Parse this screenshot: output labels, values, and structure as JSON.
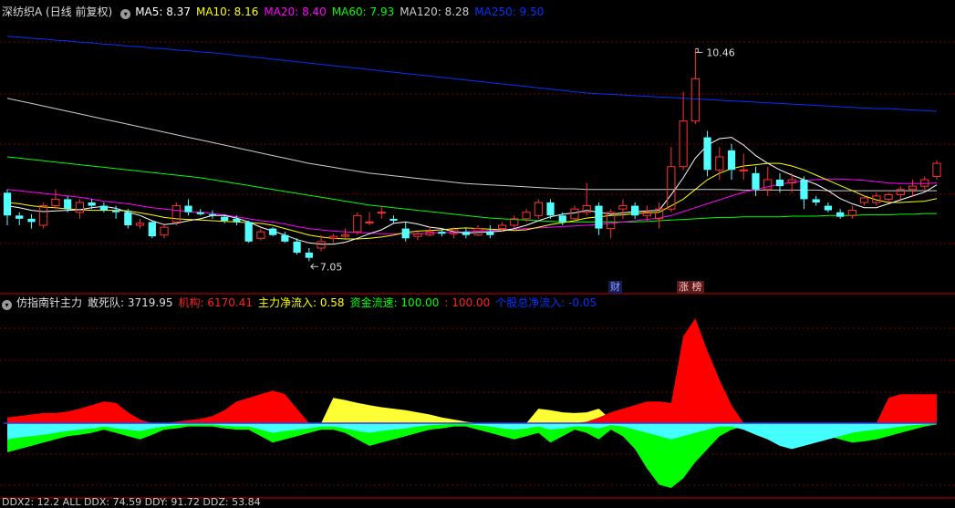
{
  "main_header": {
    "title": "深纺织A (日线 前复权)",
    "ma": [
      {
        "label": "MA5: 8.37",
        "color": "#ffffff"
      },
      {
        "label": "MA10: 8.16",
        "color": "#ffff00"
      },
      {
        "label": "MA20: 8.40",
        "color": "#ff00ff"
      },
      {
        "label": "MA60: 7.93",
        "color": "#00ff00"
      },
      {
        "label": "MA120: 8.28",
        "color": "#cccccc"
      },
      {
        "label": "MA250: 9.50",
        "color": "#0033ff"
      }
    ]
  },
  "sub_header": {
    "title": "仿指南针主力",
    "items": [
      {
        "label": "敢死队: 3719.95",
        "color": "#dddddd"
      },
      {
        "label": "机构: 6170.41",
        "color": "#ff2020"
      },
      {
        "label": "主力净流入: 0.58",
        "color": "#ffff00"
      },
      {
        "label": "资金流速: 100.00",
        "color": "#00ff00"
      },
      {
        "label": ": 100.00",
        "color": "#ff2020"
      },
      {
        "label": "个股总净流入: -0.05",
        "color": "#0033ff"
      }
    ]
  },
  "annotations": {
    "high": "10.46",
    "low": "7.05"
  },
  "tags": {
    "cai": "财",
    "zhang": "涨",
    "bang": "榜"
  },
  "footer_text": "DDX2: 12.2 ALL DDX: 74.59 DDY: 91.72 DDZ: 53.84",
  "colors": {
    "up": "#ff3232",
    "down": "#54ffff",
    "bg": "#000000",
    "grid": "#7a0000",
    "divider": "#cc0000"
  },
  "chart_data": [
    {
      "type": "candlestick",
      "title": "深纺织A (日线 前复权)",
      "y_range": [
        6.7,
        10.9
      ],
      "series_names": [
        "MA5",
        "MA10",
        "MA20",
        "MA60",
        "MA120",
        "MA250"
      ],
      "candles": [
        [
          8.25,
          8.3,
          7.75,
          7.9
        ],
        [
          7.9,
          7.95,
          7.75,
          7.85
        ],
        [
          7.85,
          7.92,
          7.7,
          7.8
        ],
        [
          7.75,
          8.1,
          7.7,
          8.05
        ],
        [
          8.05,
          8.3,
          8.0,
          8.15
        ],
        [
          8.15,
          8.2,
          7.95,
          8.0
        ],
        [
          7.95,
          8.15,
          7.85,
          8.1
        ],
        [
          8.1,
          8.15,
          8.0,
          8.05
        ],
        [
          8.05,
          8.1,
          7.95,
          7.98
        ],
        [
          7.98,
          8.05,
          7.85,
          7.95
        ],
        [
          7.95,
          8.0,
          7.7,
          7.75
        ],
        [
          7.75,
          7.85,
          7.7,
          7.78
        ],
        [
          7.8,
          7.82,
          7.55,
          7.58
        ],
        [
          7.6,
          7.75,
          7.55,
          7.72
        ],
        [
          7.8,
          8.1,
          7.75,
          8.05
        ],
        [
          8.05,
          8.15,
          7.9,
          7.95
        ],
        [
          7.95,
          8.0,
          7.9,
          7.92
        ],
        [
          7.92,
          7.98,
          7.85,
          7.9
        ],
        [
          7.88,
          7.92,
          7.78,
          7.82
        ],
        [
          7.85,
          7.9,
          7.75,
          7.8
        ],
        [
          7.8,
          7.82,
          7.48,
          7.5
        ],
        [
          7.55,
          7.7,
          7.52,
          7.65
        ],
        [
          7.7,
          7.72,
          7.58,
          7.6
        ],
        [
          7.6,
          7.65,
          7.48,
          7.5
        ],
        [
          7.5,
          7.55,
          7.3,
          7.33
        ],
        [
          7.33,
          7.4,
          7.2,
          7.25
        ],
        [
          7.4,
          7.6,
          7.35,
          7.5
        ],
        [
          7.55,
          7.62,
          7.48,
          7.58
        ],
        [
          7.58,
          7.7,
          7.55,
          7.6
        ],
        [
          7.65,
          7.95,
          7.6,
          7.9
        ],
        [
          7.8,
          7.95,
          7.75,
          7.8
        ],
        [
          7.95,
          8.05,
          7.85,
          7.95
        ],
        [
          7.85,
          7.9,
          7.78,
          7.82
        ],
        [
          7.7,
          7.8,
          7.5,
          7.55
        ],
        [
          7.58,
          7.65,
          7.52,
          7.62
        ],
        [
          7.6,
          7.72,
          7.58,
          7.65
        ],
        [
          7.65,
          7.7,
          7.58,
          7.62
        ],
        [
          7.62,
          7.72,
          7.55,
          7.68
        ],
        [
          7.65,
          7.7,
          7.55,
          7.6
        ],
        [
          7.6,
          7.75,
          7.58,
          7.7
        ],
        [
          7.65,
          7.75,
          7.55,
          7.6
        ],
        [
          7.7,
          7.8,
          7.65,
          7.75
        ],
        [
          7.75,
          7.9,
          7.7,
          7.85
        ],
        [
          7.85,
          8.0,
          7.8,
          7.95
        ],
        [
          7.9,
          8.15,
          7.85,
          8.1
        ],
        [
          8.1,
          8.15,
          7.85,
          7.9
        ],
        [
          7.9,
          7.95,
          7.75,
          7.8
        ],
        [
          7.85,
          8.05,
          7.8,
          8.0
        ],
        [
          7.95,
          8.4,
          7.9,
          8.05
        ],
        [
          8.05,
          8.1,
          7.6,
          7.7
        ],
        [
          7.7,
          8.0,
          7.55,
          7.95
        ],
        [
          8.0,
          8.15,
          7.85,
          8.05
        ],
        [
          8.05,
          8.1,
          7.85,
          7.9
        ],
        [
          7.9,
          8.05,
          7.8,
          7.95
        ],
        [
          7.85,
          8.1,
          7.7,
          8.0
        ],
        [
          8.0,
          8.95,
          7.95,
          8.65
        ],
        [
          8.65,
          9.8,
          8.6,
          9.35
        ],
        [
          9.35,
          10.46,
          9.3,
          10.0
        ],
        [
          9.1,
          9.2,
          8.5,
          8.6
        ],
        [
          8.6,
          8.95,
          8.45,
          8.8
        ],
        [
          8.9,
          9.0,
          8.45,
          8.6
        ],
        [
          8.6,
          8.85,
          8.45,
          8.6
        ],
        [
          8.55,
          8.65,
          8.2,
          8.3
        ],
        [
          8.3,
          8.65,
          8.2,
          8.45
        ],
        [
          8.45,
          8.55,
          8.25,
          8.35
        ],
        [
          8.4,
          8.55,
          8.25,
          8.45
        ],
        [
          8.45,
          8.5,
          8.0,
          8.15
        ],
        [
          8.15,
          8.2,
          8.05,
          8.1
        ],
        [
          8.05,
          8.1,
          7.95,
          7.98
        ],
        [
          7.95,
          8.0,
          7.85,
          7.88
        ],
        [
          7.9,
          8.05,
          7.85,
          7.98
        ],
        [
          8.1,
          8.2,
          8.05,
          8.17
        ],
        [
          8.1,
          8.25,
          8.05,
          8.2
        ],
        [
          8.15,
          8.25,
          8.1,
          8.22
        ],
        [
          8.22,
          8.35,
          8.15,
          8.3
        ],
        [
          8.3,
          8.45,
          8.2,
          8.35
        ],
        [
          8.35,
          8.5,
          8.3,
          8.45
        ],
        [
          8.5,
          8.75,
          8.45,
          8.7
        ]
      ],
      "ma5": [
        8.05,
        8.02,
        7.98,
        7.96,
        7.97,
        7.98,
        7.99,
        8.02,
        8.04,
        8.01,
        7.95,
        7.9,
        7.82,
        7.76,
        7.78,
        7.82,
        7.85,
        7.9,
        7.9,
        7.86,
        7.8,
        7.72,
        7.66,
        7.6,
        7.53,
        7.48,
        7.46,
        7.46,
        7.49,
        7.55,
        7.62,
        7.68,
        7.78,
        7.8,
        7.77,
        7.72,
        7.7,
        7.65,
        7.63,
        7.64,
        7.65,
        7.66,
        7.7,
        7.75,
        7.82,
        7.88,
        7.92,
        7.94,
        7.98,
        7.95,
        7.92,
        7.94,
        7.96,
        7.97,
        7.98,
        8.22,
        8.48,
        8.78,
        8.98,
        9.08,
        9.1,
        8.98,
        8.82,
        8.7,
        8.6,
        8.52,
        8.45,
        8.38,
        8.28,
        8.16,
        8.08,
        8.02,
        8.02,
        8.08,
        8.14,
        8.2,
        8.26,
        8.37
      ],
      "ma10": [
        8.1,
        8.08,
        8.05,
        8.03,
        8.02,
        8.0,
        7.99,
        7.98,
        7.98,
        7.98,
        7.97,
        7.94,
        7.91,
        7.87,
        7.85,
        7.84,
        7.83,
        7.82,
        7.81,
        7.8,
        7.79,
        7.78,
        7.75,
        7.7,
        7.65,
        7.6,
        7.57,
        7.55,
        7.54,
        7.54,
        7.55,
        7.57,
        7.6,
        7.64,
        7.66,
        7.67,
        7.68,
        7.7,
        7.71,
        7.7,
        7.69,
        7.68,
        7.67,
        7.68,
        7.72,
        7.76,
        7.79,
        7.82,
        7.86,
        7.88,
        7.9,
        7.91,
        7.93,
        7.94,
        7.95,
        8.05,
        8.15,
        8.3,
        8.45,
        8.55,
        8.62,
        8.66,
        8.68,
        8.7,
        8.7,
        8.66,
        8.6,
        8.52,
        8.44,
        8.36,
        8.28,
        8.2,
        8.14,
        8.1,
        8.1,
        8.11,
        8.12,
        8.16
      ],
      "ma20": [
        8.3,
        8.28,
        8.26,
        8.24,
        8.22,
        8.2,
        8.18,
        8.15,
        8.12,
        8.1,
        8.08,
        8.05,
        8.02,
        8.0,
        7.98,
        7.96,
        7.95,
        7.93,
        7.91,
        7.88,
        7.85,
        7.82,
        7.8,
        7.77,
        7.73,
        7.7,
        7.68,
        7.66,
        7.65,
        7.64,
        7.63,
        7.62,
        7.62,
        7.62,
        7.62,
        7.63,
        7.64,
        7.64,
        7.65,
        7.66,
        7.67,
        7.68,
        7.69,
        7.7,
        7.71,
        7.72,
        7.73,
        7.74,
        7.75,
        7.76,
        7.78,
        7.8,
        7.82,
        7.84,
        7.86,
        7.9,
        7.96,
        8.02,
        8.08,
        8.14,
        8.2,
        8.26,
        8.3,
        8.34,
        8.38,
        8.41,
        8.43,
        8.45,
        8.46,
        8.46,
        8.45,
        8.44,
        8.42,
        8.4,
        8.39,
        8.39,
        8.39,
        8.4
      ],
      "ma60": [
        8.8,
        8.78,
        8.76,
        8.74,
        8.72,
        8.7,
        8.68,
        8.66,
        8.64,
        8.62,
        8.6,
        8.58,
        8.56,
        8.54,
        8.52,
        8.5,
        8.48,
        8.45,
        8.42,
        8.39,
        8.36,
        8.33,
        8.3,
        8.27,
        8.24,
        8.21,
        8.18,
        8.15,
        8.12,
        8.09,
        8.06,
        8.04,
        8.02,
        8.0,
        7.98,
        7.96,
        7.94,
        7.92,
        7.9,
        7.88,
        7.86,
        7.85,
        7.84,
        7.83,
        7.82,
        7.81,
        7.8,
        7.8,
        7.8,
        7.8,
        7.8,
        7.8,
        7.8,
        7.81,
        7.82,
        7.83,
        7.84,
        7.85,
        7.86,
        7.87,
        7.87,
        7.88,
        7.88,
        7.88,
        7.88,
        7.89,
        7.89,
        7.89,
        7.9,
        7.9,
        7.9,
        7.91,
        7.91,
        7.91,
        7.92,
        7.92,
        7.93,
        7.93
      ],
      "ma120": [
        9.7,
        9.66,
        9.62,
        9.58,
        9.54,
        9.5,
        9.46,
        9.42,
        9.38,
        9.34,
        9.3,
        9.26,
        9.22,
        9.18,
        9.14,
        9.1,
        9.06,
        9.02,
        8.98,
        8.94,
        8.9,
        8.86,
        8.82,
        8.78,
        8.74,
        8.7,
        8.67,
        8.64,
        8.61,
        8.58,
        8.55,
        8.53,
        8.51,
        8.49,
        8.47,
        8.45,
        8.43,
        8.41,
        8.39,
        8.38,
        8.37,
        8.36,
        8.35,
        8.34,
        8.33,
        8.32,
        8.31,
        8.31,
        8.3,
        8.3,
        8.3,
        8.3,
        8.3,
        8.3,
        8.3,
        8.3,
        8.3,
        8.3,
        8.3,
        8.3,
        8.3,
        8.29,
        8.29,
        8.29,
        8.29,
        8.29,
        8.29,
        8.29,
        8.28,
        8.28,
        8.28,
        8.28,
        8.28,
        8.28,
        8.28,
        8.28,
        8.28,
        8.28
      ],
      "ma250": [
        10.65,
        10.64,
        10.62,
        10.61,
        10.59,
        10.58,
        10.56,
        10.55,
        10.53,
        10.52,
        10.5,
        10.49,
        10.47,
        10.46,
        10.44,
        10.43,
        10.41,
        10.4,
        10.38,
        10.36,
        10.34,
        10.32,
        10.3,
        10.28,
        10.26,
        10.24,
        10.22,
        10.2,
        10.18,
        10.16,
        10.14,
        10.12,
        10.1,
        10.08,
        10.06,
        10.04,
        10.02,
        10.0,
        9.98,
        9.96,
        9.94,
        9.92,
        9.9,
        9.88,
        9.86,
        9.84,
        9.82,
        9.8,
        9.78,
        9.77,
        9.76,
        9.75,
        9.74,
        9.73,
        9.72,
        9.71,
        9.7,
        9.69,
        9.68,
        9.67,
        9.66,
        9.65,
        9.64,
        9.63,
        9.62,
        9.61,
        9.6,
        9.59,
        9.58,
        9.57,
        9.56,
        9.55,
        9.54,
        9.54,
        9.53,
        9.52,
        9.51,
        9.5
      ]
    },
    {
      "type": "area",
      "title": "仿指南针主力",
      "y_range": [
        -100,
        150
      ],
      "series_names": [
        "敢死队",
        "机构",
        "主力净流入",
        "资金流速",
        "个股总净流入"
      ],
      "institution": [
        8,
        10,
        12,
        14,
        14,
        16,
        20,
        25,
        30,
        28,
        15,
        5,
        0,
        0,
        2,
        4,
        6,
        10,
        18,
        30,
        35,
        40,
        45,
        40,
        20,
        0,
        0,
        0,
        0,
        0,
        0,
        0,
        0,
        0,
        0,
        0,
        0,
        0,
        0,
        0,
        0,
        0,
        0,
        0,
        0,
        0,
        0,
        0,
        2,
        8,
        15,
        20,
        25,
        30,
        30,
        28,
        120,
        145,
        100,
        60,
        25,
        0,
        0,
        0,
        0,
        0,
        0,
        0,
        0,
        0,
        0,
        0,
        0,
        35,
        40,
        40,
        40,
        40
      ],
      "main_flow": [
        0,
        0,
        0,
        0,
        0,
        0,
        0,
        0,
        0,
        0,
        0,
        0,
        0,
        0,
        0,
        0,
        0,
        0,
        0,
        0,
        0,
        0,
        0,
        0,
        0,
        0,
        0,
        35,
        32,
        28,
        25,
        22,
        20,
        18,
        15,
        12,
        8,
        5,
        2,
        0,
        0,
        0,
        0,
        0,
        20,
        18,
        15,
        14,
        15,
        20,
        5,
        0,
        0,
        0,
        0,
        0,
        0,
        55,
        65,
        0,
        0,
        0,
        0,
        0,
        0,
        0,
        0,
        0,
        0,
        0,
        0,
        0,
        0,
        0,
        0,
        0,
        0,
        0
      ],
      "speed": [
        -45,
        -40,
        -35,
        -30,
        -25,
        -20,
        -18,
        -15,
        -10,
        -15,
        -20,
        -25,
        -18,
        -10,
        -8,
        -5,
        -5,
        -5,
        -8,
        -10,
        -10,
        -20,
        -30,
        -25,
        -20,
        -15,
        -10,
        -10,
        -15,
        -25,
        -35,
        -30,
        -25,
        -20,
        -15,
        -10,
        -8,
        -5,
        -5,
        -10,
        -15,
        -20,
        -25,
        -20,
        -15,
        -30,
        -20,
        -10,
        -15,
        -25,
        -10,
        -20,
        -40,
        -70,
        -95,
        -100,
        -85,
        -60,
        -40,
        -20,
        -10,
        -5,
        -5,
        -5,
        -5,
        -5,
        -10,
        -15,
        -20,
        -25,
        -30,
        -28,
        -25,
        -20,
        -15,
        -10,
        -5,
        -2
      ],
      "net_inflow": [
        -25,
        -22,
        -20,
        -18,
        -15,
        -12,
        -10,
        -8,
        -5,
        -8,
        -10,
        -12,
        -8,
        -5,
        -3,
        -2,
        -2,
        -2,
        -4,
        -5,
        -5,
        -10,
        -15,
        -12,
        -10,
        -8,
        -5,
        -5,
        -8,
        -12,
        -15,
        -12,
        -10,
        -8,
        -5,
        -3,
        -2,
        -1,
        -1,
        -3,
        -5,
        -8,
        -10,
        -8,
        -5,
        -10,
        -8,
        -5,
        -5,
        -8,
        -3,
        -5,
        -10,
        -15,
        -20,
        -25,
        -20,
        -15,
        -10,
        -5,
        -5,
        -10,
        -18,
        -25,
        -35,
        -40,
        -35,
        -30,
        -25,
        -20,
        -15,
        -12,
        -10,
        -8,
        -5,
        -3,
        -2,
        -1
      ]
    }
  ]
}
